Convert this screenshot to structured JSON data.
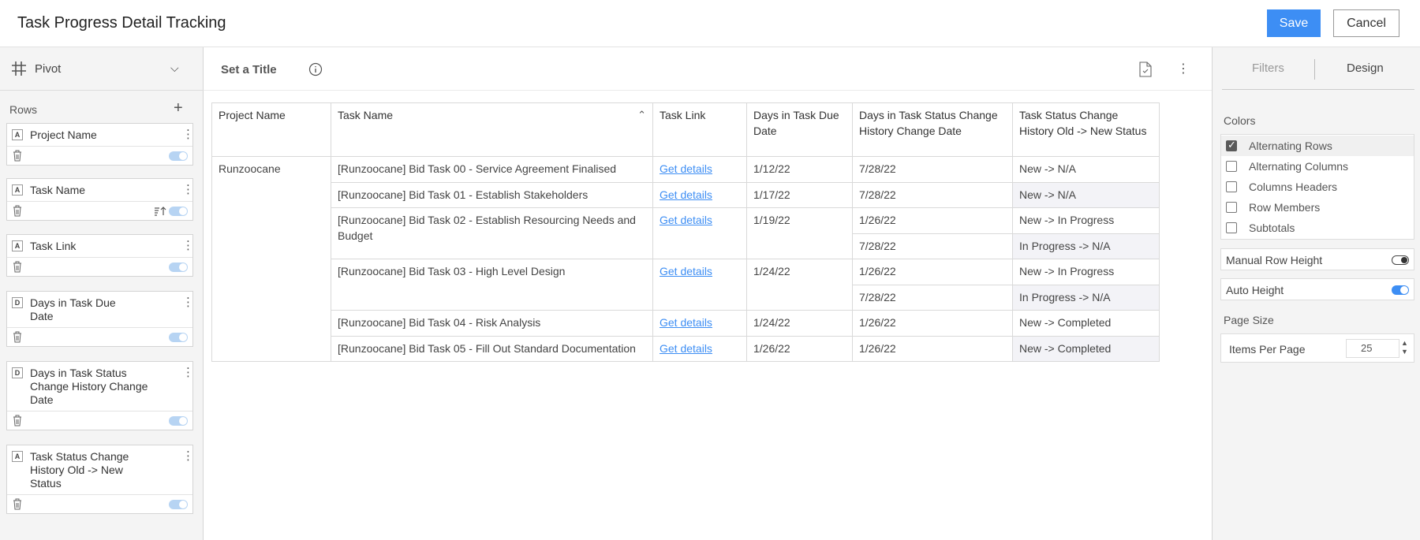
{
  "header": {
    "title": "Task Progress Detail Tracking",
    "save_label": "Save",
    "cancel_label": "Cancel"
  },
  "left": {
    "pivot_label": "Pivot",
    "rows_label": "Rows",
    "fields": [
      {
        "type": "A",
        "name": "Project Name"
      },
      {
        "type": "A",
        "name": "Task Name"
      },
      {
        "type": "A",
        "name": "Task Link"
      },
      {
        "type": "D",
        "name": "Days in Task Due Date"
      },
      {
        "type": "D",
        "name": "Days in Task Status Change History Change Date"
      },
      {
        "type": "A",
        "name": "Task Status Change History Old -> New Status"
      }
    ]
  },
  "main": {
    "set_title": "Set a Title",
    "columns": [
      "Project Name",
      "Task Name",
      "Task Link",
      "Days in Task Due Date",
      "Days in Task Status Change History Change Date",
      "Task Status Change History Old -> New Status"
    ],
    "project": "Runzoocane",
    "tasks": [
      {
        "name": "[Runzoocane] Bid Task 00 - Service Agreement Finalised",
        "link": "Get details",
        "due": "1/12/22",
        "history": [
          {
            "date": "7/28/22",
            "status": "New -> N/A"
          }
        ]
      },
      {
        "name": "[Runzoocane] Bid Task 01 - Establish Stakeholders",
        "link": "Get details",
        "due": "1/17/22",
        "history": [
          {
            "date": "7/28/22",
            "status": "New -> N/A"
          }
        ]
      },
      {
        "name": "[Runzoocane] Bid Task 02 - Establish Resourcing Needs and Budget",
        "link": "Get details",
        "due": "1/19/22",
        "history": [
          {
            "date": "1/26/22",
            "status": "New -> In Progress"
          },
          {
            "date": "7/28/22",
            "status": "In Progress -> N/A"
          }
        ]
      },
      {
        "name": "[Runzoocane] Bid Task 03 - High Level Design",
        "link": "Get details",
        "due": "1/24/22",
        "history": [
          {
            "date": "1/26/22",
            "status": "New -> In Progress"
          },
          {
            "date": "7/28/22",
            "status": "In Progress -> N/A"
          }
        ]
      },
      {
        "name": "[Runzoocane] Bid Task 04 - Risk Analysis",
        "link": "Get details",
        "due": "1/24/22",
        "history": [
          {
            "date": "1/26/22",
            "status": "New -> Completed"
          }
        ]
      },
      {
        "name": "[Runzoocane] Bid Task 05 - Fill Out Standard Documentation",
        "link": "Get details",
        "due": "1/26/22",
        "history": [
          {
            "date": "1/26/22",
            "status": "New -> Completed"
          }
        ]
      }
    ]
  },
  "right": {
    "tab_filters": "Filters",
    "tab_design": "Design",
    "colors_label": "Colors",
    "color_options": [
      {
        "label": "Alternating Rows",
        "checked": true
      },
      {
        "label": "Alternating Columns",
        "checked": false
      },
      {
        "label": "Columns Headers",
        "checked": false
      },
      {
        "label": "Row Members",
        "checked": false
      },
      {
        "label": "Subtotals",
        "checked": false
      }
    ],
    "manual_row_height": "Manual Row Height",
    "auto_height": "Auto Height",
    "page_size_label": "Page Size",
    "items_per_page_label": "Items Per Page",
    "items_per_page": "25"
  }
}
